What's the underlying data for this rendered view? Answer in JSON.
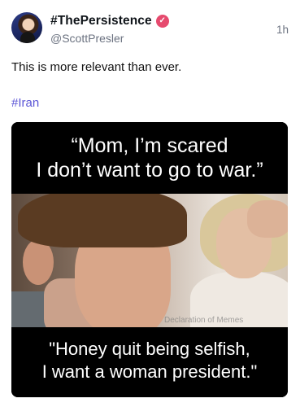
{
  "post": {
    "display_name": "#ThePersistence",
    "verified_icon": "verified-badge-icon",
    "handle": "@ScottPresler",
    "timestamp": "1h",
    "text": "This is more relevant than ever.",
    "hashtag": "#Iran"
  },
  "meme": {
    "top_caption_line1": "“Mom, I’m scared",
    "top_caption_line2": "I don’t want to go to war.”",
    "watermark": "Declaration of Memes",
    "bottom_caption_line1": "\"Honey quit being selfish,",
    "bottom_caption_line2": "I want a woman president.\""
  },
  "colors": {
    "hashtag": "#5b55d6",
    "verified_badge": "#e64a6e",
    "secondary_text": "#6b7280"
  }
}
